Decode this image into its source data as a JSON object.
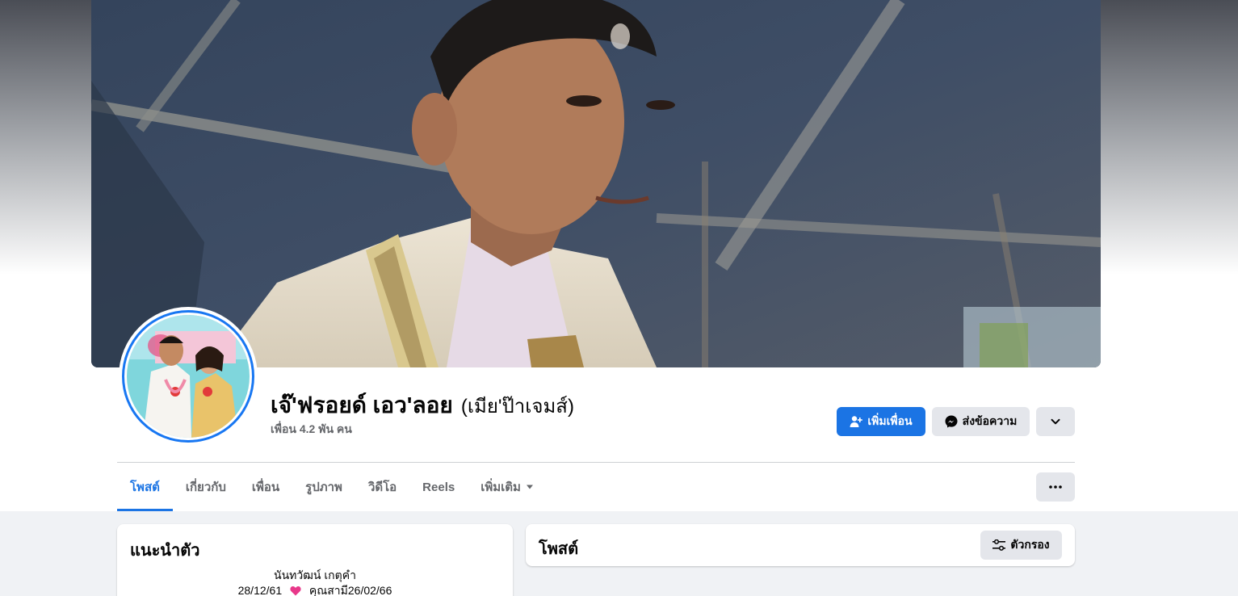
{
  "profile": {
    "name": "เจ๊'ฟรอยด์ เอว'ลอย",
    "alternate_name": "(เมีย'ป๊าเจมส์)",
    "friends_count": "เพื่อน 4.2 พัน คน"
  },
  "actions": {
    "add_friend": "เพิ่มเพื่อน",
    "message": "ส่งข้อความ"
  },
  "tabs": [
    {
      "label": "โพสต์",
      "active": true
    },
    {
      "label": "เกี่ยวกับ"
    },
    {
      "label": "เพื่อน"
    },
    {
      "label": "รูปภาพ"
    },
    {
      "label": "วิดีโอ"
    },
    {
      "label": "Reels"
    },
    {
      "label": "เพิ่มเติม"
    }
  ],
  "intro": {
    "title": "แนะนำตัว",
    "bio_line1": "นันทวัฒน์ เกตุคำ",
    "bio_line2_left": "28/12/61",
    "bio_line2_right": "คุณสามี26/02/66"
  },
  "posts": {
    "title": "โพสต์",
    "filter_label": "ตัวกรอง"
  },
  "colors": {
    "accent": "#1b74e4",
    "secondary_button": "#e4e6eb",
    "heart": "#e8388a"
  },
  "icons": {
    "add_friend": "person-plus-icon",
    "message": "messenger-icon",
    "dropdown": "chevron-down-icon",
    "more": "ellipsis-icon",
    "filter": "sliders-icon",
    "heart": "heart-icon"
  }
}
